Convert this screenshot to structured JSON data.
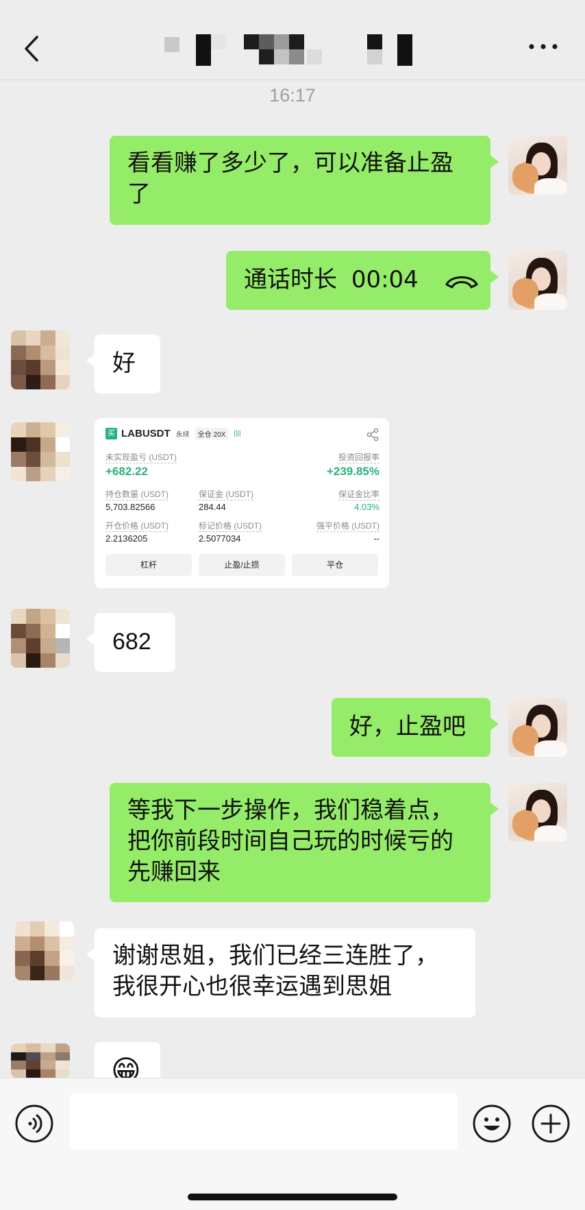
{
  "timestamp": "16:17",
  "messages": {
    "m1": {
      "text": "看看赚了多少了，可以准备止盈了"
    },
    "m2": {
      "label": "通话时长",
      "duration": "00:04"
    },
    "m3": {
      "text": "好"
    },
    "m5": {
      "text": "682"
    },
    "m6": {
      "text": "好，止盈吧"
    },
    "m7": {
      "text": "等我下一步操作，我们稳着点，把你前段时间自己玩的时候亏的先赚回来"
    },
    "m8": {
      "text": "谢谢思姐，我们已经三连胜了，我很开心也很幸运遇到思姐"
    },
    "m9": {
      "emoji": "😁"
    }
  },
  "trade": {
    "side": "买",
    "symbol": "LABUSDT",
    "type": "永续",
    "margin_mode": "全仓 20X",
    "pnl_label": "未实现盈亏 (USDT)",
    "pnl_value": "+682.22",
    "roi_label": "投资回报率",
    "roi_value": "+239.85%",
    "qty_label": "持仓数量 (USDT)",
    "qty_value": "5,703.82566",
    "margin_label": "保证金 (USDT)",
    "margin_value": "284.44",
    "ratio_label": "保证金比率",
    "ratio_value": "4.03%",
    "entry_label": "开仓价格 (USDT)",
    "entry_value": "2.2136205",
    "mark_label": "标记价格 (USDT)",
    "mark_value": "2.5077034",
    "liq_label": "强平价格 (USDT)",
    "liq_value": "--",
    "btn_leverage": "杠杆",
    "btn_tpsl": "止盈/止损",
    "btn_close": "平仓"
  },
  "input": {
    "placeholder": ""
  },
  "icons": {
    "back": "chevron-left-icon",
    "more": "more-dots-icon",
    "voice": "voice-icon",
    "emoji": "emoji-icon",
    "plus": "plus-icon",
    "call": "phone-hangup-icon",
    "share": "share-icon"
  },
  "colors": {
    "green_bubble": "#95ec69",
    "white_bubble": "#ffffff",
    "background": "#ededed",
    "profit_green": "#25b27a"
  }
}
